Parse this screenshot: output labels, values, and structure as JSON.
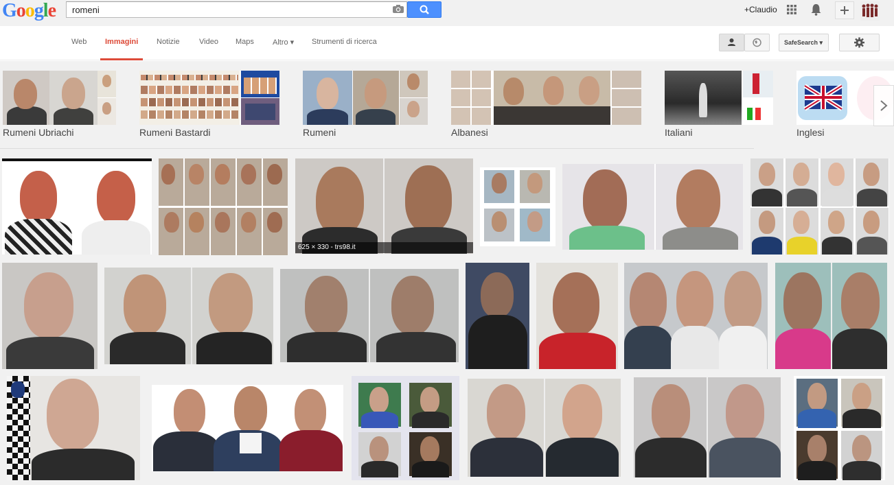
{
  "header": {
    "logo_letters": [
      {
        "ch": "G",
        "color": "#4285f4"
      },
      {
        "ch": "o",
        "color": "#ea4335"
      },
      {
        "ch": "o",
        "color": "#fbbc05"
      },
      {
        "ch": "g",
        "color": "#4285f4"
      },
      {
        "ch": "l",
        "color": "#34a853"
      },
      {
        "ch": "e",
        "color": "#ea4335"
      }
    ],
    "search_value": "romeni",
    "user_label": "+Claudio"
  },
  "nav": {
    "tabs": [
      {
        "label": "Web",
        "active": false
      },
      {
        "label": "Immagini",
        "active": true
      },
      {
        "label": "Notizie",
        "active": false
      },
      {
        "label": "Video",
        "active": false
      },
      {
        "label": "Maps",
        "active": false
      },
      {
        "label": "Altro ▾",
        "active": false
      },
      {
        "label": "Strumenti di ricerca",
        "active": false
      }
    ],
    "safesearch_label": "SafeSearch ▾"
  },
  "related": [
    {
      "label": "Rumeni Ubriachi"
    },
    {
      "label": "Rumeni Bastardi"
    },
    {
      "label": "Rumeni"
    },
    {
      "label": "Albanesi"
    },
    {
      "label": "Italiani"
    },
    {
      "label": "Inglesi"
    }
  ],
  "results": {
    "hover_caption": "625 × 330 - trs98.it"
  },
  "colors": {
    "accent": "#dd4b39",
    "search_button": "#4d90fe",
    "background": "#f1f1f1"
  }
}
